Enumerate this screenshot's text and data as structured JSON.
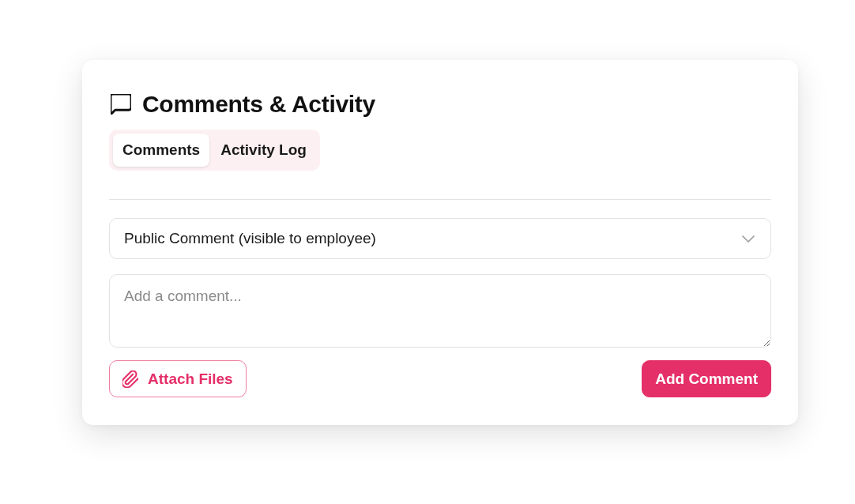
{
  "header": {
    "title": "Comments & Activity"
  },
  "tabs": [
    {
      "label": "Comments",
      "selected": true
    },
    {
      "label": "Activity Log",
      "selected": false
    }
  ],
  "comment_type": {
    "value": "Public Comment (visible to employee)"
  },
  "comment_box": {
    "placeholder": "Add a comment..."
  },
  "buttons": [
    {
      "label": "Attach Files",
      "kind": "outline"
    },
    {
      "label": "Add Comment",
      "kind": "primary"
    }
  ]
}
